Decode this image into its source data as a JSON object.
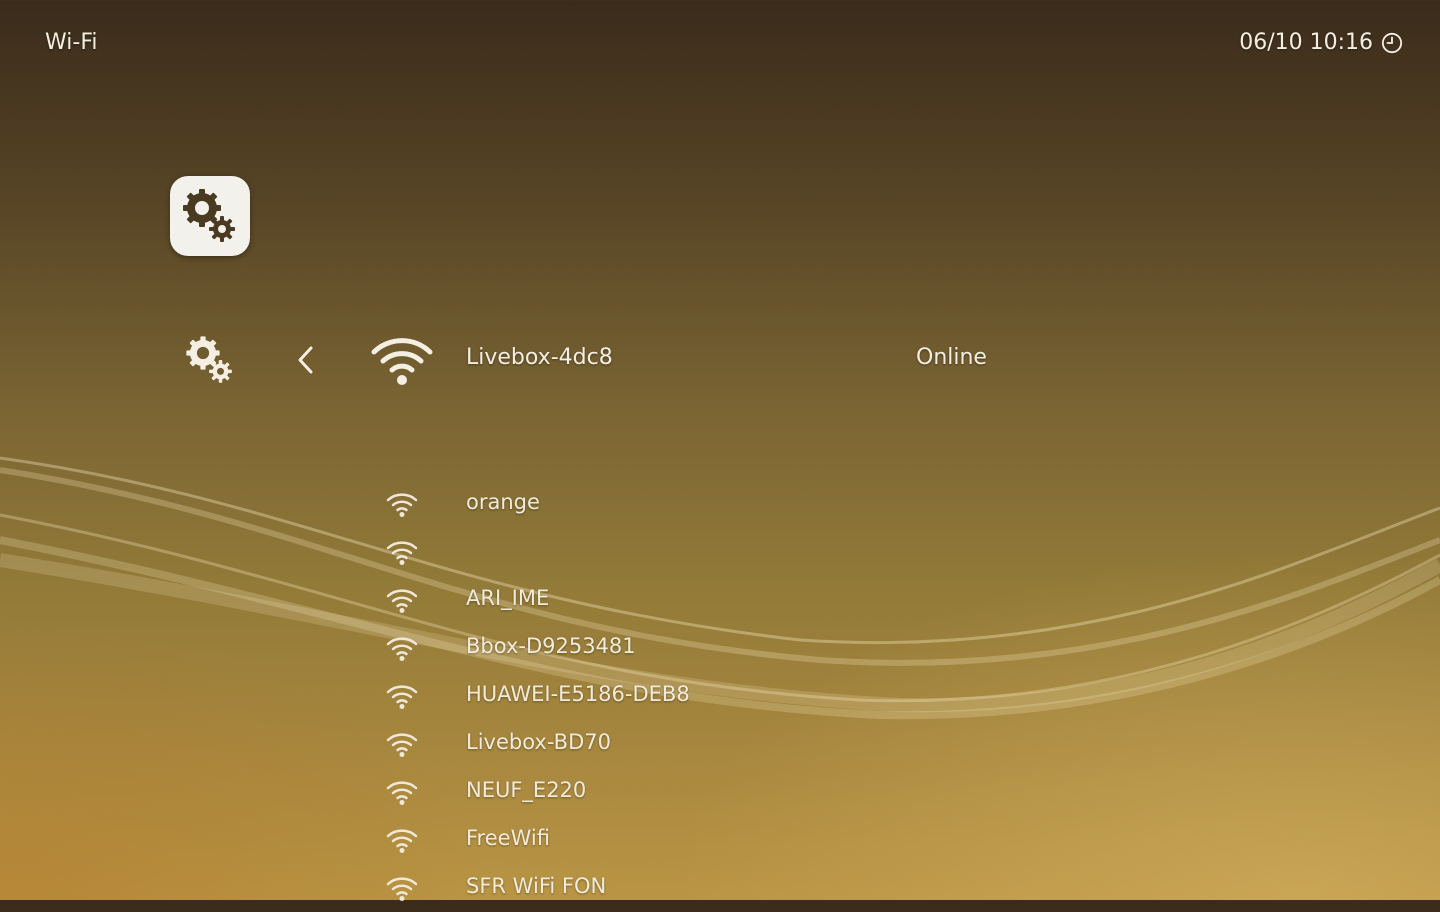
{
  "header": {
    "title": "Wi-Fi",
    "datetime": "06/10 10:16",
    "clock_icon": "clock-icon"
  },
  "app_tile": {
    "icon": "settings-gears-icon"
  },
  "current_connection": {
    "category_icon": "settings-gears-icon",
    "back_icon": "chevron-left-icon",
    "signal_icon": "wifi-icon",
    "ssid": "Livebox-4dc8",
    "status": "Online"
  },
  "networks": [
    {
      "ssid": "orange"
    },
    {
      "ssid": ""
    },
    {
      "ssid": "ARI_IME"
    },
    {
      "ssid": "Bbox-D9253481"
    },
    {
      "ssid": "HUAWEI-E5186-DEB8"
    },
    {
      "ssid": "Livebox-BD70"
    },
    {
      "ssid": "NEUF_E220"
    },
    {
      "ssid": "FreeWifi"
    },
    {
      "ssid": "SFR WiFi FON"
    }
  ]
}
